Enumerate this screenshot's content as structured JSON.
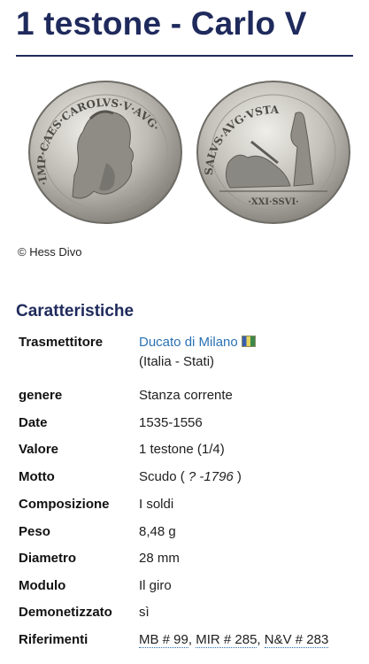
{
  "page": {
    "title": "1 testone - Carlo V",
    "image_credit": "© Hess Divo",
    "section_title": "Caratteristiche"
  },
  "coins": {
    "obverse_legend": "·IMP·CAES·CAROLVS·V·AVG·",
    "reverse_legend": "SALVS·AVG·VSTA",
    "reverse_exergue": "·XXI·SSVI·"
  },
  "characteristics": {
    "trasmettitore": {
      "label": "Trasmettitore",
      "link": "Ducato di Milano",
      "sub": "(Italia - Stati)",
      "flag_icon": "flag-icon"
    },
    "genere": {
      "label": "genere",
      "value": "Stanza corrente"
    },
    "date": {
      "label": "Date",
      "value": "1535-1556"
    },
    "valore": {
      "label": "Valore",
      "value": "1 testone (1/4)"
    },
    "motto": {
      "label": "Motto",
      "value_prefix": "Scudo ( ",
      "value_italic": "? -1796",
      "value_suffix": " )"
    },
    "composizione": {
      "label": "Composizione",
      "value": "I soldi"
    },
    "peso": {
      "label": "Peso",
      "value": "8,48 g"
    },
    "diametro": {
      "label": "Diametro",
      "value": "28 mm"
    },
    "modulo": {
      "label": "Modulo",
      "value": "Il giro"
    },
    "demonetizzato": {
      "label": "Demonetizzato",
      "value": "sì"
    },
    "riferimenti": {
      "label": "Riferimenti",
      "refs": [
        "MB # 99",
        "MIR # 285",
        "N&V # 283"
      ]
    }
  },
  "colors": {
    "title": "#1f2a5c",
    "link": "#2a72b5",
    "coin_silver": "#bfbdb6"
  }
}
